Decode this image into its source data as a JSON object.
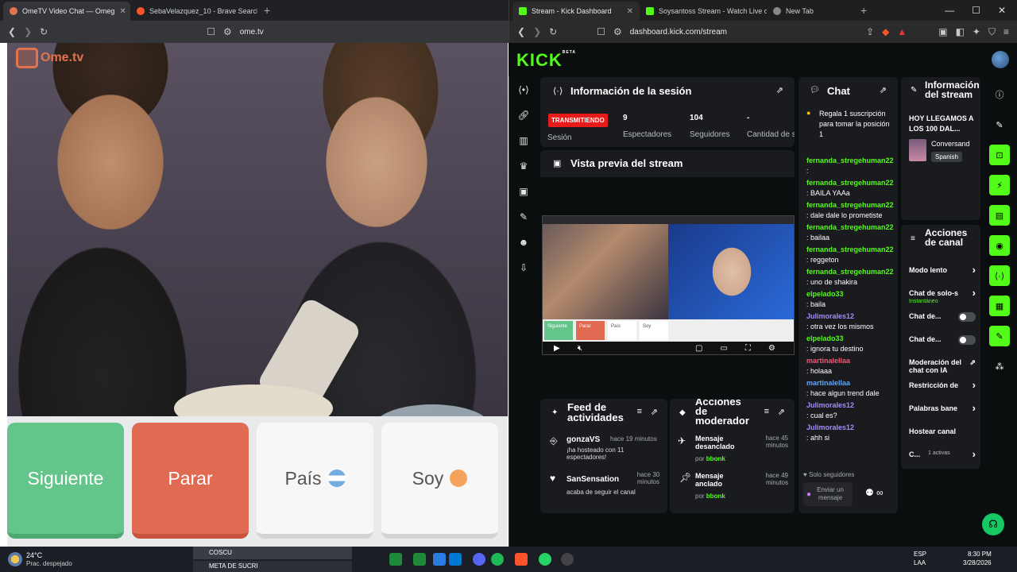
{
  "left_browser": {
    "tabs": [
      {
        "label": "OmeTV Video Chat — Omeg",
        "active": true
      },
      {
        "label": "SebaVelazquez_10 - Brave Search",
        "active": false
      }
    ],
    "url": "ome.tv",
    "logo_text": "Ome.tv",
    "buttons": {
      "next": "Siguiente",
      "stop": "Parar",
      "country": "País",
      "gender": "Soy"
    }
  },
  "right_browser": {
    "tabs": [
      {
        "label": "Stream - Kick Dashboard",
        "active": true
      },
      {
        "label": "Soysantoss Stream - Watch Live on K",
        "active": false
      },
      {
        "label": "New Tab",
        "active": false
      }
    ],
    "url": "dashboard.kick.com/stream",
    "logo": "KICK",
    "logo_sup": "BETA"
  },
  "session": {
    "title": "Información de la sesión",
    "badge": "TRANSMITIENDO",
    "session_label": "Sesión",
    "viewers_n": "9",
    "viewers_l": "Espectadores",
    "followers_n": "104",
    "followers_l": "Seguidores",
    "subs_n": "-",
    "subs_l": "Cantidad de suscripciones"
  },
  "preview": {
    "title": "Vista previa del stream",
    "mini_buttons": [
      "Siguiente",
      "Parar",
      "País",
      "Soy"
    ]
  },
  "chat": {
    "title": "Chat",
    "pinned": "Regala 1 suscripción para tomar la posición 1",
    "messages": [
      {
        "user": "fernanda_stregehuman22",
        "text": ":",
        "color": "green"
      },
      {
        "user": "fernanda_stregehuman22",
        "text": ": BAILA YAAa",
        "color": "green"
      },
      {
        "user": "fernanda_stregehuman22",
        "text": ": dale dale lo prometiste",
        "color": "green"
      },
      {
        "user": "fernanda_stregehuman22",
        "text": ": bailaa",
        "color": "green"
      },
      {
        "user": "fernanda_stregehuman22",
        "text": ": reggeton",
        "color": "green"
      },
      {
        "user": "fernanda_stregehuman22",
        "text": ": uno de shakira",
        "color": "green"
      },
      {
        "user": "elpelado33",
        "text": ": baila",
        "color": "green"
      },
      {
        "user": "Julimorales12",
        "text": ": otra vez los mismos",
        "color": "purple"
      },
      {
        "user": "elpelado33",
        "text": ": ignora tu destino",
        "color": "green"
      },
      {
        "user": "martinalellaa",
        "text": ": holaaa",
        "color": "red"
      },
      {
        "user": "martinalellaa",
        "text": ": hace algun trend dale",
        "color": "blue"
      },
      {
        "user": "Julimorales12",
        "text": ": cual es?",
        "color": "purple"
      },
      {
        "user": "Julimorales12",
        "text": ": ahh si",
        "color": "purple"
      }
    ],
    "followers_only": "Solo seguidores",
    "input_placeholder": "Enviar un mensaje"
  },
  "stream_info": {
    "title": "Información del stream",
    "stream_title": "HOY LLEGAMOS A LOS 100 DAL...",
    "category": "Conversand",
    "language": "Spanish"
  },
  "channel_actions": {
    "title": "Acciones de canal",
    "items": [
      {
        "label": "Modo lento",
        "sub": ""
      },
      {
        "label": "Chat de solo-s",
        "sub": "Instantáneo"
      },
      {
        "label": "Chat de...",
        "sub": ""
      },
      {
        "label": "Chat de...",
        "sub": ""
      },
      {
        "label": "Moderación del chat con IA",
        "sub": ""
      },
      {
        "label": "Restricción de",
        "sub": ""
      },
      {
        "label": "Palabras bane",
        "sub": ""
      },
      {
        "label": "Hostear canal",
        "sub": ""
      },
      {
        "label": "C...",
        "sub": "1 activas"
      }
    ]
  },
  "activity_feed": {
    "title": "Feed de actividades",
    "items": [
      {
        "user": "gonzaVS",
        "time": "hace 19 minutos",
        "text": "¡ha hosteado con 11 espectadores!"
      },
      {
        "user": "SanSensation",
        "time": "hace 30 minutos",
        "text": "acaba de seguir el canal"
      }
    ]
  },
  "mod_actions": {
    "title": "Acciones de moderador",
    "items": [
      {
        "action": "Mensaje desanclado",
        "by": "bbonk",
        "time": "hace 45 minutos"
      },
      {
        "action": "Mensaje anclado",
        "by": "bbonk",
        "time": "hace 49 minutos"
      }
    ],
    "by_prefix": "por"
  },
  "taskbar": {
    "weather_temp": "24°C",
    "weather_desc": "Prac. despejado",
    "stream_items": [
      "COSCU",
      "META DE SUCRI"
    ],
    "lang": "ESP",
    "lang2": "LAA",
    "time": "8:30 PM",
    "date": "3/28/2026"
  }
}
